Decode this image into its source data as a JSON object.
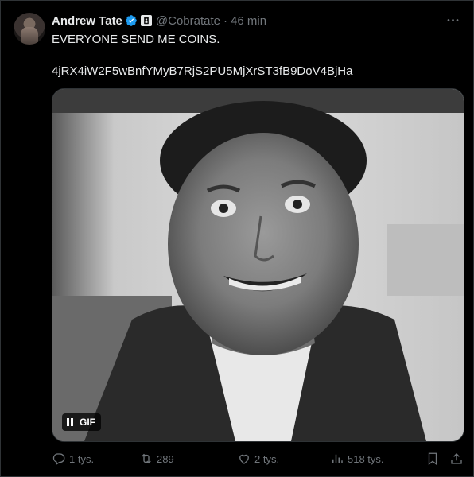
{
  "tweet": {
    "author_name": "Andrew Tate",
    "handle": "@Cobratate",
    "separator": "·",
    "time": "46 min",
    "text_line1": "EVERYONE SEND ME COINS.",
    "text_line2": "4jRX4iW2F5wBnfYMyB7RjS2PU5MjXrST3fB9DoV4BjHa",
    "media_badge": "GIF"
  },
  "actions": {
    "replies": "1 tys.",
    "reposts": "289",
    "likes": "2 tys.",
    "views": "518 tys."
  },
  "colors": {
    "background": "#000000",
    "text": "#e7e9ea",
    "muted": "#71767b",
    "verified": "#1d9bf0"
  },
  "icons": [
    "verified-badge-icon",
    "affiliate-badge-icon",
    "more-icon",
    "pause-icon",
    "reply-icon",
    "repost-icon",
    "like-icon",
    "views-icon",
    "bookmark-icon",
    "share-icon"
  ]
}
